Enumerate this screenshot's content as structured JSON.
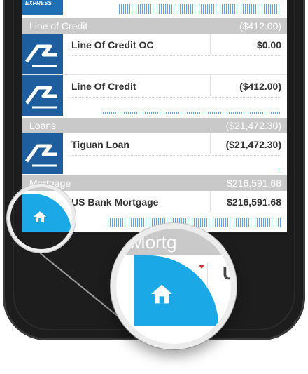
{
  "top_row": {
    "logo_text": "EXPRESS"
  },
  "sections": [
    {
      "name": "Line of Credit",
      "total": "($412.00)",
      "accounts": [
        {
          "name": "Line Of Credit OC",
          "balance": "$0.00"
        },
        {
          "name": "Line Of Credit",
          "balance": "($412.00)"
        }
      ]
    },
    {
      "name": "Loans",
      "total": "($21,472.30)",
      "accounts": [
        {
          "name": "Tiguan Loan",
          "balance": "($21,472.30)"
        }
      ]
    },
    {
      "name": "Mortgage",
      "total": "$216,591.68",
      "accounts": [
        {
          "name": "US Bank Mortgage",
          "balance": "$216,591.68"
        }
      ]
    }
  ],
  "magnifier": {
    "header_fragment": "Mortg",
    "letter_fragment": "U"
  },
  "icons": {
    "home": "home-icon",
    "bank_logo": "bank-logo-icon"
  },
  "colors": {
    "accent": "#1aa9e6",
    "section_header": "#c9c9c9",
    "logo_blue": "#1e5e9e",
    "phone_body": "#1d1d1d"
  }
}
